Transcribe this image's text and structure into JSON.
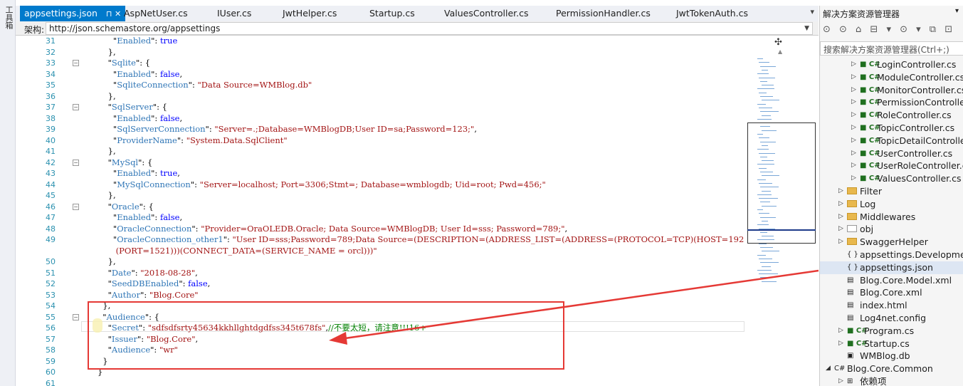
{
  "tool_strip_label": "工具箱",
  "tabs": [
    {
      "label": "appsettings.json",
      "active": true
    },
    {
      "label": "AspNetUser.cs"
    },
    {
      "label": "IUser.cs"
    },
    {
      "label": "JwtHelper.cs"
    },
    {
      "label": "Startup.cs"
    },
    {
      "label": "ValuesController.cs"
    },
    {
      "label": "PermissionHandler.cs"
    },
    {
      "label": "JwtTokenAuth.cs"
    }
  ],
  "tab_controls": "⊓ ✕",
  "schema": {
    "label": "架构:",
    "url": "http://json.schemastore.org/appsettings"
  },
  "code_lines": [
    {
      "n": "31",
      "segs": [
        [
          "p",
          "      \""
        ],
        [
          "k",
          "Enabled"
        ],
        [
          "p",
          "\": "
        ],
        [
          "b",
          "true"
        ]
      ],
      "fold": false
    },
    {
      "n": "32",
      "segs": [
        [
          "p",
          "    },"
        ]
      ],
      "fold": false
    },
    {
      "n": "33",
      "segs": [
        [
          "p",
          "    \""
        ],
        [
          "k",
          "Sqlite"
        ],
        [
          "p",
          "\": {"
        ]
      ],
      "fold": true
    },
    {
      "n": "34",
      "segs": [
        [
          "p",
          "      \""
        ],
        [
          "k",
          "Enabled"
        ],
        [
          "p",
          "\": "
        ],
        [
          "b",
          "false"
        ],
        [
          "p",
          ","
        ]
      ],
      "fold": false
    },
    {
      "n": "35",
      "segs": [
        [
          "p",
          "      \""
        ],
        [
          "k",
          "SqliteConnection"
        ],
        [
          "p",
          "\": "
        ],
        [
          "s",
          "\"Data Source=WMBlog.db\""
        ]
      ],
      "fold": false
    },
    {
      "n": "36",
      "segs": [
        [
          "p",
          "    },"
        ]
      ],
      "fold": false
    },
    {
      "n": "37",
      "segs": [
        [
          "p",
          "    \""
        ],
        [
          "k",
          "SqlServer"
        ],
        [
          "p",
          "\": {"
        ]
      ],
      "fold": true
    },
    {
      "n": "38",
      "segs": [
        [
          "p",
          "      \""
        ],
        [
          "k",
          "Enabled"
        ],
        [
          "p",
          "\": "
        ],
        [
          "b",
          "false"
        ],
        [
          "p",
          ","
        ]
      ],
      "fold": false
    },
    {
      "n": "39",
      "segs": [
        [
          "p",
          "      \""
        ],
        [
          "k",
          "SqlServerConnection"
        ],
        [
          "p",
          "\": "
        ],
        [
          "s",
          "\"Server=.;Database=WMBlogDB;User ID=sa;Password=123;\""
        ],
        [
          "p",
          ","
        ]
      ],
      "fold": false
    },
    {
      "n": "40",
      "segs": [
        [
          "p",
          "      \""
        ],
        [
          "k",
          "ProviderName"
        ],
        [
          "p",
          "\": "
        ],
        [
          "s",
          "\"System.Data.SqlClient\""
        ]
      ],
      "fold": false
    },
    {
      "n": "41",
      "segs": [
        [
          "p",
          "    },"
        ]
      ],
      "fold": false
    },
    {
      "n": "42",
      "segs": [
        [
          "p",
          "    \""
        ],
        [
          "k",
          "MySql"
        ],
        [
          "p",
          "\": {"
        ]
      ],
      "fold": true
    },
    {
      "n": "43",
      "segs": [
        [
          "p",
          "      \""
        ],
        [
          "k",
          "Enabled"
        ],
        [
          "p",
          "\": "
        ],
        [
          "b",
          "true"
        ],
        [
          "p",
          ","
        ]
      ],
      "fold": false
    },
    {
      "n": "44",
      "segs": [
        [
          "p",
          "      \""
        ],
        [
          "k",
          "MySqlConnection"
        ],
        [
          "p",
          "\": "
        ],
        [
          "s",
          "\"Server=localhost; Port=3306;Stmt=; Database=wmblogdb; Uid=root; Pwd=456;\""
        ]
      ],
      "fold": false
    },
    {
      "n": "45",
      "segs": [
        [
          "p",
          "    },"
        ]
      ],
      "fold": false
    },
    {
      "n": "46",
      "segs": [
        [
          "p",
          "    \""
        ],
        [
          "k",
          "Oracle"
        ],
        [
          "p",
          "\": {"
        ]
      ],
      "fold": true
    },
    {
      "n": "47",
      "segs": [
        [
          "p",
          "      \""
        ],
        [
          "k",
          "Enabled"
        ],
        [
          "p",
          "\": "
        ],
        [
          "b",
          "false"
        ],
        [
          "p",
          ","
        ]
      ],
      "fold": false
    },
    {
      "n": "48",
      "segs": [
        [
          "p",
          "      \""
        ],
        [
          "k",
          "OracleConnection"
        ],
        [
          "p",
          "\": "
        ],
        [
          "s",
          "\"Provider=OraOLEDB.Oracle; Data Source=WMBlogDB; User Id=sss; Password=789;\""
        ],
        [
          "p",
          ","
        ]
      ],
      "fold": false
    },
    {
      "n": "49",
      "segs": [
        [
          "p",
          "      \""
        ],
        [
          "k",
          "OracleConnection_other1"
        ],
        [
          "p",
          "\": "
        ],
        [
          "s",
          "\"User ID=sss;Password=789;Data Source=(DESCRIPTION=(ADDRESS_LIST=(ADDRESS=(PROTOCOL=TCP)(HOST=192.168.8.65)"
        ]
      ],
      "fold": false
    },
    {
      "n": "",
      "segs": [
        [
          "s",
          "       (PORT=1521)))(CONNECT_DATA=(SERVICE_NAME = orcl)))\""
        ]
      ],
      "fold": false
    },
    {
      "n": "50",
      "segs": [
        [
          "p",
          "    },"
        ]
      ],
      "fold": false
    },
    {
      "n": "51",
      "segs": [
        [
          "p",
          "    \""
        ],
        [
          "k",
          "Date"
        ],
        [
          "p",
          "\": "
        ],
        [
          "s",
          "\"2018-08-28\""
        ],
        [
          "p",
          ","
        ]
      ],
      "fold": false
    },
    {
      "n": "52",
      "segs": [
        [
          "p",
          "    \""
        ],
        [
          "k",
          "SeedDBEnabled"
        ],
        [
          "p",
          "\": "
        ],
        [
          "b",
          "false"
        ],
        [
          "p",
          ","
        ]
      ],
      "fold": false
    },
    {
      "n": "53",
      "segs": [
        [
          "p",
          "    \""
        ],
        [
          "k",
          "Author"
        ],
        [
          "p",
          "\": "
        ],
        [
          "s",
          "\"Blog.Core\""
        ]
      ],
      "fold": false
    },
    {
      "n": "54",
      "segs": [
        [
          "p",
          "  },"
        ]
      ],
      "fold": false
    },
    {
      "n": "55",
      "segs": [
        [
          "p",
          "  \""
        ],
        [
          "k",
          "Audience"
        ],
        [
          "p",
          "\": {"
        ]
      ],
      "fold": true
    },
    {
      "n": "56",
      "segs": [
        [
          "p",
          "    \""
        ],
        [
          "k",
          "Secret"
        ],
        [
          "p",
          "\": "
        ],
        [
          "s",
          "\"sdfsdfsrty45634kkhllghtdgdfss345t678fs\""
        ],
        [
          "p",
          ","
        ],
        [
          "c",
          "//不要太短，请注意!!!16+"
        ]
      ],
      "fold": false
    },
    {
      "n": "57",
      "segs": [
        [
          "p",
          "    \""
        ],
        [
          "k",
          "Issuer"
        ],
        [
          "p",
          "\": "
        ],
        [
          "s",
          "\"Blog.Core\""
        ],
        [
          "p",
          ","
        ]
      ],
      "fold": false
    },
    {
      "n": "58",
      "segs": [
        [
          "p",
          "    \""
        ],
        [
          "k",
          "Audience"
        ],
        [
          "p",
          "\": "
        ],
        [
          "s",
          "\"wr\""
        ]
      ],
      "fold": false
    },
    {
      "n": "59",
      "segs": [
        [
          "p",
          "  }"
        ]
      ],
      "fold": false
    },
    {
      "n": "60",
      "segs": [
        [
          "p",
          "}"
        ]
      ],
      "fold": false
    },
    {
      "n": "61",
      "segs": [],
      "fold": false
    }
  ],
  "solution_explorer": {
    "title": "解决方案资源管理器",
    "toolbar_icons": "⊙ ⊙ ⌂ ⊟ ▾ ⊙ ▾ ⧉ ⊡",
    "search_placeholder": "搜索解决方案资源管理器(Ctrl+;)",
    "items": [
      {
        "label": "LoginController.cs",
        "kind": "cs",
        "indent": 2,
        "arrow": "▷"
      },
      {
        "label": "ModuleController.cs",
        "kind": "cs",
        "indent": 2,
        "arrow": "▷"
      },
      {
        "label": "MonitorController.cs",
        "kind": "cs",
        "indent": 2,
        "arrow": "▷"
      },
      {
        "label": "PermissionController",
        "kind": "cs",
        "indent": 2,
        "arrow": "▷"
      },
      {
        "label": "RoleController.cs",
        "kind": "cs",
        "indent": 2,
        "arrow": "▷"
      },
      {
        "label": "TopicController.cs",
        "kind": "cs",
        "indent": 2,
        "arrow": "▷"
      },
      {
        "label": "TopicDetailControlle",
        "kind": "cs",
        "indent": 2,
        "arrow": "▷"
      },
      {
        "label": "UserController.cs",
        "kind": "cs",
        "indent": 2,
        "arrow": "▷"
      },
      {
        "label": "UserRoleController.c",
        "kind": "cs",
        "indent": 2,
        "arrow": "▷"
      },
      {
        "label": "ValuesController.cs",
        "kind": "cs",
        "indent": 2,
        "arrow": "▷"
      },
      {
        "label": "Filter",
        "kind": "folder",
        "indent": 1,
        "arrow": "▷"
      },
      {
        "label": "Log",
        "kind": "folder",
        "indent": 1,
        "arrow": "▷"
      },
      {
        "label": "Middlewares",
        "kind": "folder",
        "indent": 1,
        "arrow": "▷"
      },
      {
        "label": "obj",
        "kind": "emptyfolder",
        "indent": 1,
        "arrow": "▷"
      },
      {
        "label": "SwaggerHelper",
        "kind": "folder",
        "indent": 1,
        "arrow": "▷"
      },
      {
        "label": "appsettings.Developme",
        "kind": "json",
        "indent": 1,
        "arrow": ""
      },
      {
        "label": "appsettings.json",
        "kind": "json",
        "indent": 1,
        "arrow": "",
        "selected": true
      },
      {
        "label": "Blog.Core.Model.xml",
        "kind": "file",
        "indent": 1,
        "arrow": ""
      },
      {
        "label": "Blog.Core.xml",
        "kind": "file",
        "indent": 1,
        "arrow": ""
      },
      {
        "label": "index.html",
        "kind": "file",
        "indent": 1,
        "arrow": ""
      },
      {
        "label": "Log4net.config",
        "kind": "file",
        "indent": 1,
        "arrow": ""
      },
      {
        "label": "Program.cs",
        "kind": "cs",
        "indent": 1,
        "arrow": "▷"
      },
      {
        "label": "Startup.cs",
        "kind": "cs",
        "indent": 1,
        "arrow": "▷"
      },
      {
        "label": "WMBlog.db",
        "kind": "db",
        "indent": 1,
        "arrow": ""
      },
      {
        "label": "Blog.Core.Common",
        "kind": "proj",
        "indent": 0,
        "arrow": "◢"
      },
      {
        "label": "依赖项",
        "kind": "deps",
        "indent": 1,
        "arrow": "▷"
      }
    ]
  },
  "colors": {
    "accent": "#007acc",
    "annotation": "#e53935"
  }
}
